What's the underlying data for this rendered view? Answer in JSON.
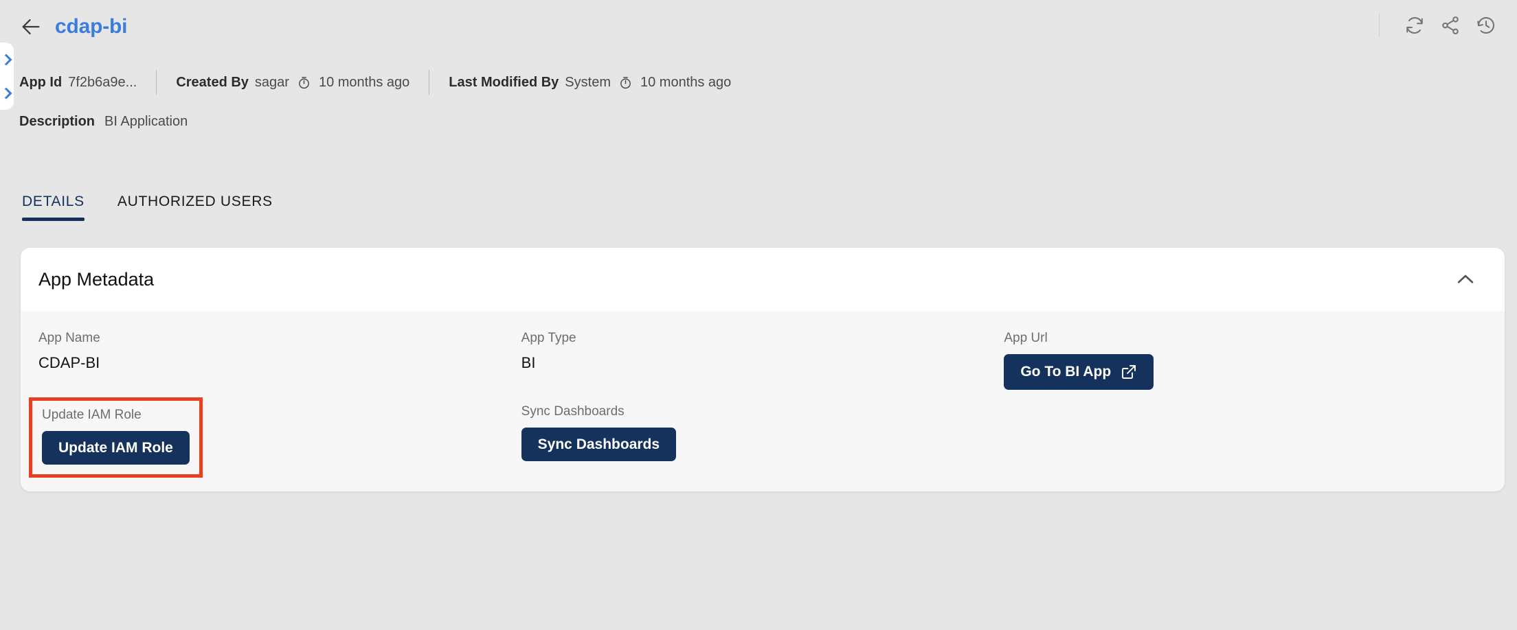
{
  "header": {
    "back_icon": "arrow-left-icon",
    "title": "cdap-bi",
    "actions": [
      {
        "name": "refresh-icon",
        "label": "Refresh"
      },
      {
        "name": "share-icon",
        "label": "Share"
      },
      {
        "name": "history-icon",
        "label": "History"
      }
    ],
    "meta": [
      {
        "label": "App Id",
        "value": "7f2b6a9e...",
        "time": "",
        "has_clock": false
      },
      {
        "label": "Created By",
        "value": "sagar",
        "time": "10 months ago",
        "has_clock": true
      },
      {
        "label": "Last Modified By",
        "value": "System",
        "time": "10 months ago",
        "has_clock": true
      }
    ],
    "description_label": "Description",
    "description_value": "BI Application"
  },
  "tabs": [
    {
      "label": "DETAILS",
      "active": true
    },
    {
      "label": "AUTHORIZED USERS",
      "active": false
    }
  ],
  "card": {
    "title": "App Metadata",
    "collapse_icon": "chevron-up-icon",
    "fields": {
      "app_name_label": "App Name",
      "app_name_value": "CDAP-BI",
      "app_type_label": "App Type",
      "app_type_value": "BI",
      "app_url_label": "App Url",
      "app_url_button": "Go To BI App",
      "update_iam_label": "Update IAM Role",
      "update_iam_button": "Update IAM Role",
      "sync_dash_label": "Sync Dashboards",
      "sync_dash_button": "Sync Dashboards"
    }
  },
  "colors": {
    "page_background": "#e6e6e6",
    "card_header_background": "#ffffff",
    "card_body_background": "#f7f7f8",
    "title_blue": "#3b7ddd",
    "tab_active_navy": "#16305c",
    "button_navy": "#15325c",
    "highlight_red": "#e8401f",
    "label_gray": "#6d6d6d"
  }
}
